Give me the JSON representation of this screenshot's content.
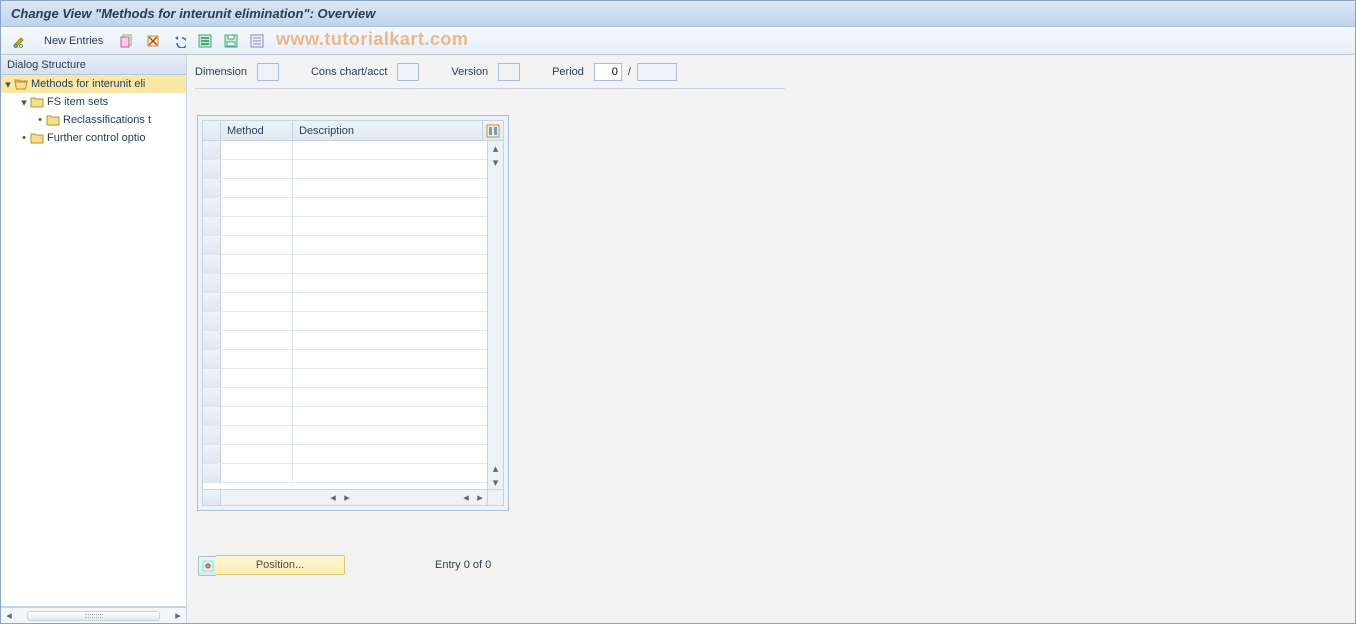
{
  "title": "Change View \"Methods for interunit elimination\": Overview",
  "watermark": "www.tutorialkart.com",
  "toolbar": {
    "new_entries_label": "New Entries"
  },
  "sidebar": {
    "header": "Dialog Structure",
    "items": [
      {
        "label": "Methods for interunit eli",
        "level": 0,
        "open": true,
        "selected": true,
        "icon": "folder-open"
      },
      {
        "label": "FS item sets",
        "level": 1,
        "open": true,
        "selected": false,
        "icon": "folder"
      },
      {
        "label": "Reclassifications t",
        "level": 2,
        "open": false,
        "selected": false,
        "icon": "folder"
      },
      {
        "label": "Further control optio",
        "level": 1,
        "open": false,
        "selected": false,
        "icon": "folder"
      }
    ]
  },
  "filters": {
    "dimension_label": "Dimension",
    "dimension_value": "",
    "cons_chart_label": "Cons chart/acct",
    "cons_chart_value": "",
    "version_label": "Version",
    "version_value": "",
    "period_label": "Period",
    "period_value1": "0",
    "period_sep": "/",
    "period_value2": ""
  },
  "table": {
    "columns": {
      "method": "Method",
      "description": "Description"
    },
    "row_count": 18
  },
  "footer": {
    "position_label": "Position...",
    "entry_status": "Entry 0 of 0"
  }
}
